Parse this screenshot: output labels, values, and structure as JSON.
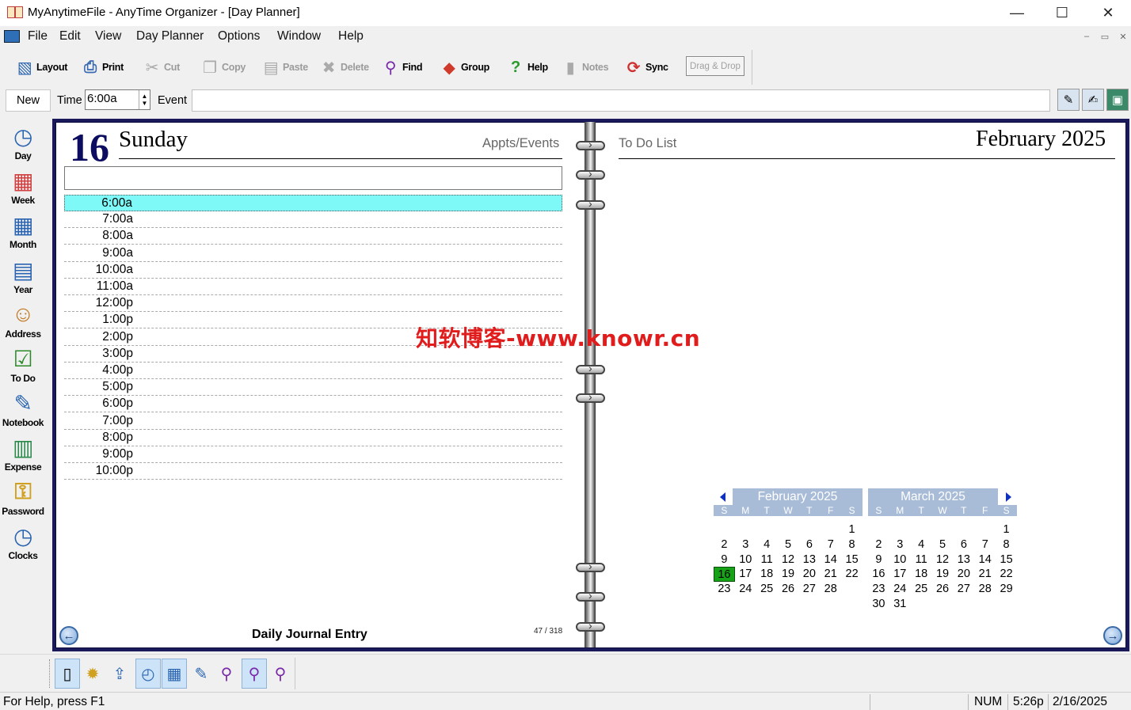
{
  "window": {
    "title": "MyAnytimeFile - AnyTime Organizer - [Day Planner]",
    "controls": [
      "—",
      "☐",
      "✕"
    ]
  },
  "menu": [
    "File",
    "Edit",
    "View",
    "Day Planner",
    "Options",
    "Window",
    "Help"
  ],
  "mdi_controls": [
    "–",
    "▭",
    "✕"
  ],
  "toolbar": {
    "buttons": [
      {
        "label": "Layout",
        "icon": "layout-icon",
        "enabled": true
      },
      {
        "label": "Print",
        "icon": "print-icon",
        "enabled": true
      },
      {
        "label": "Cut",
        "icon": "cut-icon",
        "enabled": false
      },
      {
        "label": "Copy",
        "icon": "copy-icon",
        "enabled": false
      },
      {
        "label": "Paste",
        "icon": "paste-icon",
        "enabled": false
      },
      {
        "label": "Delete",
        "icon": "delete-icon",
        "enabled": false
      },
      {
        "label": "Find",
        "icon": "find-icon",
        "enabled": true
      },
      {
        "label": "Group",
        "icon": "group-icon",
        "enabled": true
      },
      {
        "label": "Help",
        "icon": "help-icon",
        "enabled": true
      },
      {
        "label": "Notes",
        "icon": "notes-icon",
        "enabled": false
      },
      {
        "label": "Sync",
        "icon": "sync-icon",
        "enabled": true
      }
    ],
    "drag_drop": "Drag & Drop"
  },
  "event_bar": {
    "new_label": "New",
    "time_label": "Time",
    "time_value": "6:00a",
    "event_label": "Event",
    "event_value": ""
  },
  "sidebar": [
    "Day",
    "Week",
    "Month",
    "Year",
    "Address",
    "To Do",
    "Notebook",
    "Expense",
    "Password",
    "Clocks"
  ],
  "day_page": {
    "day_number": "16",
    "day_name": "Sunday",
    "section_label": "Appts/Events",
    "time_slots": [
      "6:00a",
      "7:00a",
      "8:00a",
      "9:00a",
      "10:00a",
      "11:00a",
      "12:00p",
      "1:00p",
      "2:00p",
      "3:00p",
      "4:00p",
      "5:00p",
      "6:00p",
      "7:00p",
      "8:00p",
      "9:00p",
      "10:00p"
    ],
    "selected_slot": "6:00a",
    "footer_label": "Daily Journal Entry",
    "page_count": "47 / 318"
  },
  "right_page": {
    "todo_label": "To Do List",
    "month_title": "February 2025"
  },
  "watermark": "知软博客-www.knowr.cn",
  "mini_calendars": [
    {
      "title": "February 2025",
      "dow": [
        "S",
        "M",
        "T",
        "W",
        "T",
        "F",
        "S"
      ],
      "days": [
        "",
        "",
        "",
        "",
        "",
        "",
        "1",
        "2",
        "3",
        "4",
        "5",
        "6",
        "7",
        "8",
        "9",
        "10",
        "11",
        "12",
        "13",
        "14",
        "15",
        "16",
        "17",
        "18",
        "19",
        "20",
        "21",
        "22",
        "23",
        "24",
        "25",
        "26",
        "27",
        "28",
        ""
      ],
      "today": "16"
    },
    {
      "title": "March 2025",
      "dow": [
        "S",
        "M",
        "T",
        "W",
        "T",
        "F",
        "S"
      ],
      "days": [
        "",
        "",
        "",
        "",
        "",
        "",
        "1",
        "2",
        "3",
        "4",
        "5",
        "6",
        "7",
        "8",
        "9",
        "10",
        "11",
        "12",
        "13",
        "14",
        "15",
        "16",
        "17",
        "18",
        "19",
        "20",
        "21",
        "22",
        "23",
        "24",
        "25",
        "26",
        "27",
        "28",
        "29",
        "30",
        "31"
      ],
      "today": ""
    }
  ],
  "status": {
    "help": "For Help, press F1",
    "num": "NUM",
    "time": "5:26p",
    "date": "2/16/2025"
  },
  "colors": {
    "selected_slot": "#7ff8f8",
    "today_highlight": "#17a317",
    "page_border": "#1a1a5a",
    "calendar_header": "#a8bcd8",
    "watermark": "#e01c1c"
  }
}
